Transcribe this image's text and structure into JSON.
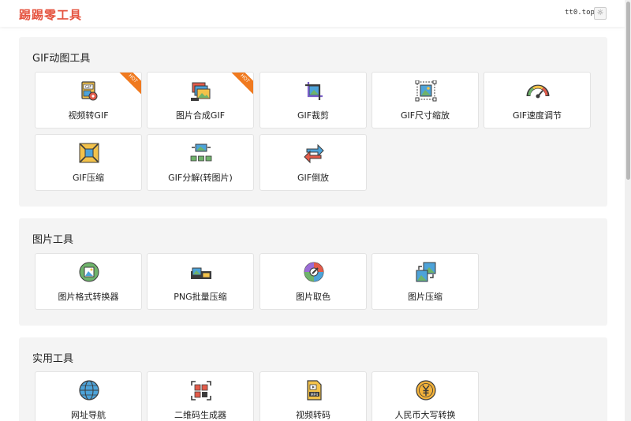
{
  "header": {
    "brand": "踢踢零工具",
    "domain": "tt0.top",
    "theme_icon": "sun-icon"
  },
  "sections": [
    {
      "title": "GIF动图工具",
      "items": [
        {
          "label": "视频转GIF",
          "icon": "video-to-gif-icon",
          "badge": "HOT"
        },
        {
          "label": "图片合成GIF",
          "icon": "images-to-gif-icon",
          "badge": "HOT"
        },
        {
          "label": "GIF裁剪",
          "icon": "crop-icon"
        },
        {
          "label": "GIF尺寸缩放",
          "icon": "resize-icon"
        },
        {
          "label": "GIF速度调节",
          "icon": "speedometer-icon"
        },
        {
          "label": "GIF压缩",
          "icon": "compress-icon"
        },
        {
          "label": "GIF分解(转图片)",
          "icon": "split-frames-icon"
        },
        {
          "label": "GIF倒放",
          "icon": "reverse-icon"
        }
      ]
    },
    {
      "title": "图片工具",
      "items": [
        {
          "label": "图片格式转换器",
          "icon": "format-convert-icon"
        },
        {
          "label": "PNG批量压缩",
          "icon": "batch-compress-icon"
        },
        {
          "label": "图片取色",
          "icon": "color-picker-icon"
        },
        {
          "label": "图片压缩",
          "icon": "image-compress-icon"
        }
      ]
    },
    {
      "title": "实用工具",
      "items": [
        {
          "label": "网址导航",
          "icon": "globe-icon"
        },
        {
          "label": "二维码生成器",
          "icon": "qrcode-icon"
        },
        {
          "label": "视频转码",
          "icon": "mp4-file-icon"
        },
        {
          "label": "人民币大写转换",
          "icon": "yuan-coin-icon"
        }
      ]
    }
  ],
  "colors": {
    "brand": "#e5533f",
    "hot_badge": "#f07a1f",
    "section_bg": "#f4f4f4"
  }
}
